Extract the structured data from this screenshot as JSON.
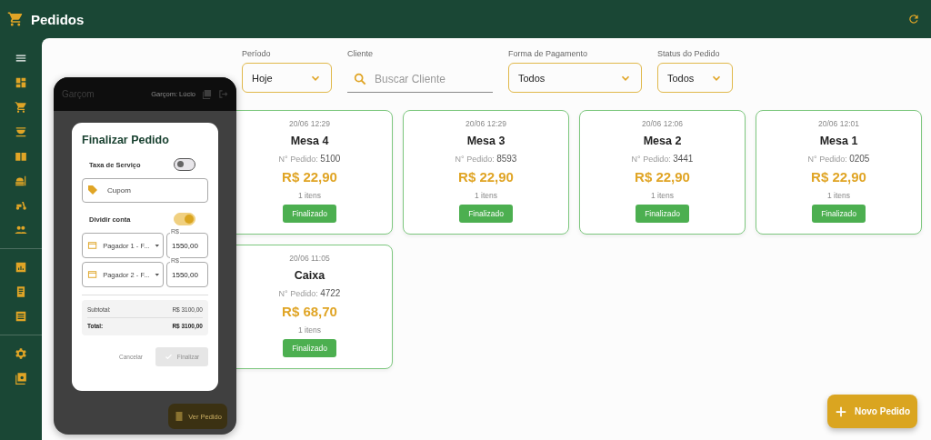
{
  "app_bar": {
    "title": "Pedidos"
  },
  "filters": [
    {
      "kind": "select",
      "label": "Período",
      "value": "Hoje"
    },
    {
      "kind": "search",
      "label": "Cliente",
      "placeholder": "Buscar Cliente"
    },
    {
      "kind": "select",
      "label": "Forma de Pagamento",
      "value": "Todos"
    },
    {
      "kind": "select",
      "label": "Status do Pedido",
      "value": "Todos"
    }
  ],
  "orders": [
    {
      "date": "20/06 12:29",
      "title": "Mesa 4",
      "number_label": "N° Pedido:",
      "number": "5100",
      "total": "R$ 22,90",
      "items": "1 itens",
      "status": "Finalizado"
    },
    {
      "date": "20/06 12:29",
      "title": "Mesa 3",
      "number_label": "N° Pedido:",
      "number": "8593",
      "total": "R$ 22,90",
      "items": "1 itens",
      "status": "Finalizado"
    },
    {
      "date": "20/06 12:06",
      "title": "Mesa 2",
      "number_label": "N° Pedido:",
      "number": "3441",
      "total": "R$ 22,90",
      "items": "1 itens",
      "status": "Finalizado"
    },
    {
      "date": "20/06 12:01",
      "title": "Mesa 1",
      "number_label": "N° Pedido:",
      "number": "0205",
      "total": "R$ 22,90",
      "items": "1 itens",
      "status": "Finalizado"
    },
    {
      "date": "20/06 11:05",
      "title": "Caixa",
      "number_label": "N° Pedido:",
      "number": "4722",
      "total": "R$ 68,70",
      "items": "1 itens",
      "status": "Finalizado"
    }
  ],
  "new_order_button": "Novo Pedido",
  "phone": {
    "title": "Garçom",
    "user": "Garçom: Lúcio",
    "view_order_button": "Ver Pedido",
    "dialog": {
      "title": "Finalizar Pedido",
      "rows": [
        {
          "kind": "toggle",
          "label": "Taxa de Serviço",
          "on": false
        },
        {
          "kind": "field",
          "placeholder": "Cupom"
        },
        {
          "kind": "toggle",
          "label": "Dividir conta",
          "on": true
        },
        {
          "kind": "payer",
          "value": "Pagador 1 - F...",
          "amount_label": "R$",
          "amount": "1550,00"
        },
        {
          "kind": "payer",
          "value": "Pagador 2 - F...",
          "amount_label": "R$",
          "amount": "1550,00"
        }
      ],
      "summary": [
        {
          "label": "Subtotal:",
          "value": "R$ 3100,00"
        },
        {
          "label": "Total:",
          "value": "R$ 3100,00"
        }
      ],
      "cancel": "Cancelar",
      "confirm": {
        "label": "Finalizar",
        "disabled": true
      }
    }
  }
}
